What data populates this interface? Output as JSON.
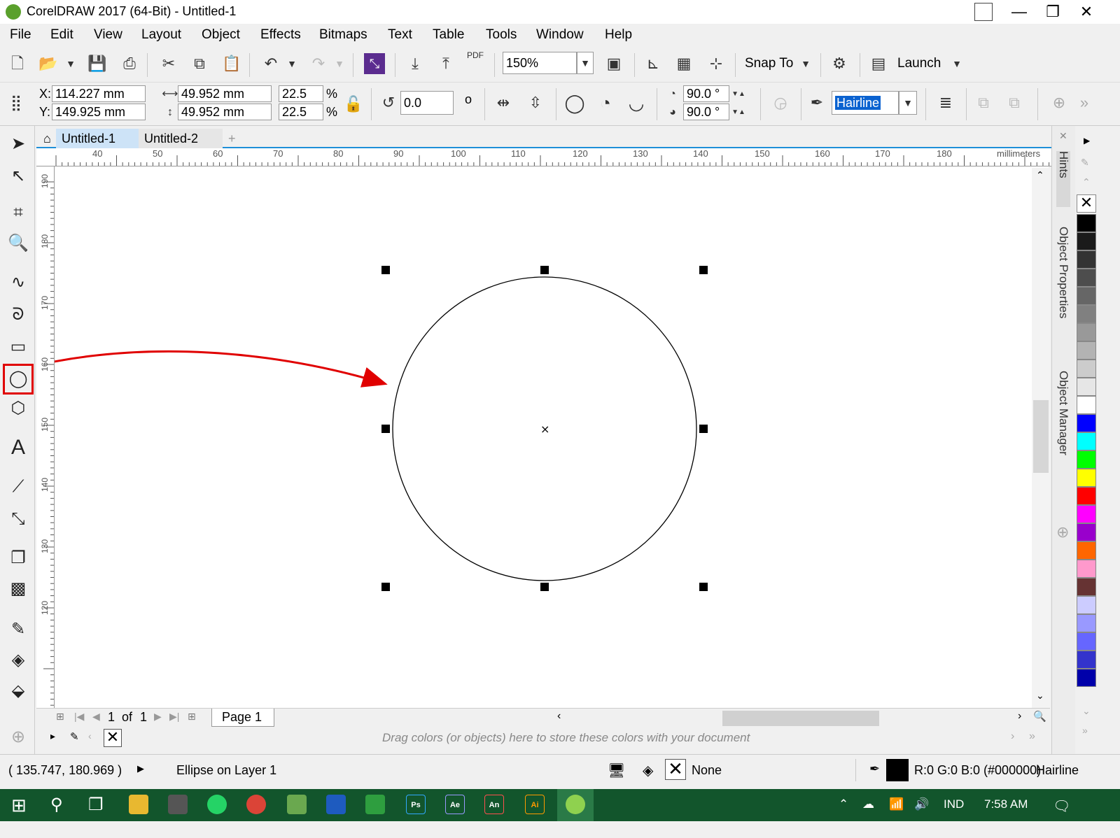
{
  "window": {
    "title": "CorelDRAW 2017 (64-Bit) - Untitled-1",
    "minimize": "—",
    "restore": "❐",
    "close": "✕"
  },
  "menu": [
    {
      "label": "File"
    },
    {
      "label": "Edit"
    },
    {
      "label": "View"
    },
    {
      "label": "Layout"
    },
    {
      "label": "Object"
    },
    {
      "label": "Effects"
    },
    {
      "label": "Bitmaps"
    },
    {
      "label": "Text"
    },
    {
      "label": "Table"
    },
    {
      "label": "Tools"
    },
    {
      "label": "Window"
    },
    {
      "label": "Help"
    }
  ],
  "toolbar": {
    "zoom": "150%",
    "pdf_label": "PDF",
    "snap_to": "Snap To",
    "launch": "Launch"
  },
  "property_bar": {
    "x_label": "X:",
    "x_value": "114.227 mm",
    "y_label": "Y:",
    "y_value": "149.925 mm",
    "width": "49.952 mm",
    "height": "49.952 mm",
    "scale_w": "22.5",
    "scale_h": "22.5",
    "percent": "%",
    "rotation": "0.0",
    "degree_symbol": "o",
    "start_angle": "90.0 °",
    "end_angle": "90.0 °",
    "outline_width": "Hairline"
  },
  "doc_tabs": [
    {
      "label": "Untitled-1",
      "active": true
    },
    {
      "label": "Untitled-2",
      "active": false
    }
  ],
  "ruler": {
    "h_ticks": [
      "40",
      "50",
      "60",
      "70",
      "80",
      "90",
      "100",
      "110",
      "120",
      "130",
      "140",
      "150",
      "160",
      "170",
      "180"
    ],
    "unit": "millimeters",
    "v_ticks": [
      "190",
      "180",
      "170",
      "160",
      "150",
      "140",
      "130",
      "120"
    ]
  },
  "page_nav": {
    "current": "1",
    "of": "of",
    "total": "1",
    "page_tab": "Page 1"
  },
  "color_well_hint": "Drag colors (or objects) here to store these colors with your document",
  "dockers": {
    "hints": "Hints",
    "object_properties": "Object Properties",
    "object_manager": "Object Manager"
  },
  "palette": {
    "colors": [
      "#000000",
      "#1a1a1a",
      "#333333",
      "#4d4d4d",
      "#666666",
      "#808080",
      "#999999",
      "#b3b3b3",
      "#cccccc",
      "#e6e6e6",
      "#ffffff",
      "#0000ff",
      "#00ffff",
      "#00ff00",
      "#ffff00",
      "#ff0000",
      "#ff00ff",
      "#9900cc",
      "#ff6600",
      "#ff99cc",
      "#663333",
      "#ccccff",
      "#9999ff",
      "#6666ff",
      "#3333cc",
      "#0000aa"
    ]
  },
  "status": {
    "cursor_pos": "( 135.747, 180.969 )",
    "object_info": "Ellipse on Layer 1",
    "fill": "None",
    "outline_color": "R:0 G:0 B:0 (#000000)",
    "outline_width": "Hairline"
  },
  "taskbar": {
    "apps": [
      {
        "name": "Ps",
        "color": "#001e36"
      },
      {
        "name": "Ae",
        "color": "#1f0740"
      },
      {
        "name": "An",
        "color": "#330000"
      },
      {
        "name": "Ai",
        "color": "#330000"
      }
    ],
    "language": "IND",
    "time": "7:58 AM"
  },
  "accent_color": "#1e8fd8",
  "highlight_color": "#e00000"
}
